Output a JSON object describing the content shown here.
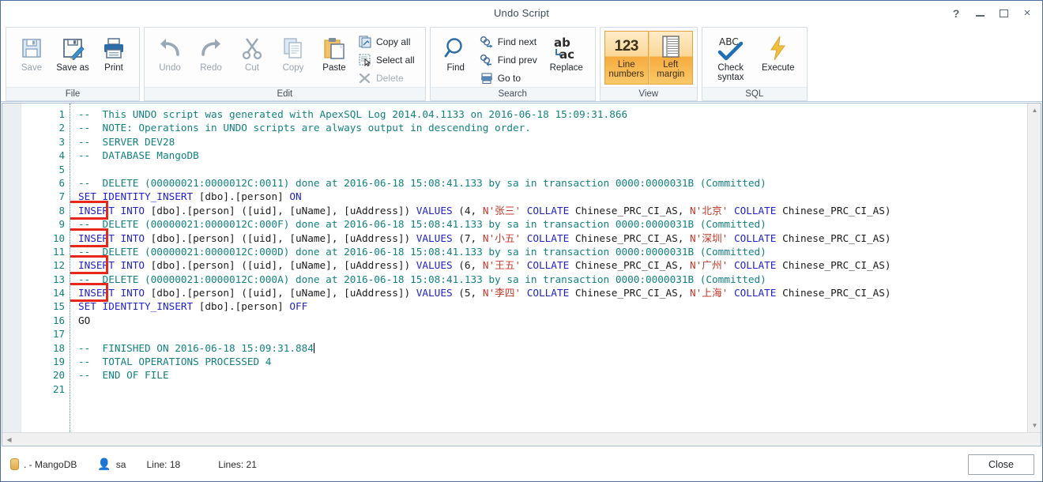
{
  "window": {
    "title": "Undo Script",
    "controls": [
      {
        "name": "help-button",
        "glyph": "?"
      },
      {
        "name": "minimize-button",
        "glyph": ""
      },
      {
        "name": "maximize-button",
        "glyph": ""
      },
      {
        "name": "close-button",
        "glyph": "×"
      }
    ]
  },
  "ribbon": {
    "groups": [
      {
        "label": "File",
        "big": [
          {
            "label": "Save",
            "icon": "save-icon",
            "disabled": true
          },
          {
            "label": "Save as",
            "icon": "save-as-icon",
            "disabled": false
          },
          {
            "label": "Print",
            "icon": "print-icon",
            "disabled": false
          }
        ]
      },
      {
        "label": "Edit",
        "big": [
          {
            "label": "Undo",
            "icon": "undo-icon",
            "disabled": true
          },
          {
            "label": "Redo",
            "icon": "redo-icon",
            "disabled": true
          },
          {
            "label": "Cut",
            "icon": "cut-icon",
            "disabled": true
          },
          {
            "label": "Copy",
            "icon": "copy-icon",
            "disabled": true
          },
          {
            "label": "Paste",
            "icon": "paste-icon",
            "disabled": false
          }
        ],
        "small": [
          {
            "label": "Copy all",
            "icon": "copy-all-icon",
            "disabled": false
          },
          {
            "label": "Select all",
            "icon": "select-all-icon",
            "disabled": false
          },
          {
            "label": "Delete",
            "icon": "delete-icon",
            "disabled": true
          }
        ]
      },
      {
        "label": "Search",
        "big": [
          {
            "label": "Find",
            "icon": "magnifier-icon",
            "disabled": false
          }
        ],
        "small": [
          {
            "label": "Find next",
            "icon": "find-next-icon",
            "disabled": false
          },
          {
            "label": "Find prev",
            "icon": "find-prev-icon",
            "disabled": false
          },
          {
            "label": "Go to",
            "icon": "go-to-icon",
            "disabled": false
          }
        ],
        "big2": [
          {
            "label": "Replace",
            "icon": "replace-icon",
            "disabled": false
          }
        ]
      },
      {
        "label": "View",
        "toggles": [
          {
            "label": "Line\nnumbers",
            "icon": "line-numbers-icon",
            "glyph": "123",
            "active": true
          },
          {
            "label": "Left\nmargin",
            "icon": "left-margin-icon",
            "glyph": "",
            "active": true
          }
        ]
      },
      {
        "label": "SQL",
        "big": [
          {
            "label": "Check\nsyntax",
            "icon": "check-syntax-icon",
            "disabled": false
          },
          {
            "label": "Execute",
            "icon": "execute-icon",
            "disabled": false
          }
        ]
      }
    ]
  },
  "editor": {
    "line_numbers": [
      1,
      2,
      3,
      4,
      5,
      6,
      7,
      8,
      9,
      10,
      11,
      12,
      13,
      14,
      15,
      16,
      17,
      18,
      19,
      20,
      21
    ],
    "colors": {
      "comment": "#138080",
      "keyword": "#2222cc",
      "string": "#c0392b",
      "plain": "#1b1b1b",
      "annotation_box": "#e8261a"
    },
    "lines": [
      {
        "n": 1,
        "tokens": [
          {
            "t": "cm",
            "v": "--  This UNDO script was generated with ApexSQL Log 2014.04.1133 on 2016-06-18 15:09:31.866"
          }
        ]
      },
      {
        "n": 2,
        "tokens": [
          {
            "t": "cm",
            "v": "--  NOTE: Operations in UNDO scripts are always output in descending order."
          }
        ]
      },
      {
        "n": 3,
        "tokens": [
          {
            "t": "cm",
            "v": "--  SERVER DEV28"
          }
        ]
      },
      {
        "n": 4,
        "tokens": [
          {
            "t": "cm",
            "v": "--  DATABASE MangoDB"
          }
        ]
      },
      {
        "n": 5,
        "tokens": []
      },
      {
        "n": 6,
        "tokens": [
          {
            "t": "cm",
            "v": "--  DELETE (00000021:0000012C:0011) done at 2016-06-18 15:08:41.133 by sa in transaction 0000:0000031B (Committed)"
          }
        ]
      },
      {
        "n": 7,
        "tokens": [
          {
            "t": "kw",
            "v": "SET IDENTITY_INSERT"
          },
          {
            "t": "pl",
            "v": " [dbo].[person] "
          },
          {
            "t": "kw",
            "v": "ON"
          }
        ]
      },
      {
        "n": 8,
        "tokens": [
          {
            "t": "kw",
            "v": "INSERT INTO"
          },
          {
            "t": "pl",
            "v": " [dbo].[person] ([uid], [uName], [uAddress]) "
          },
          {
            "t": "kw",
            "v": "VALUES"
          },
          {
            "t": "pl",
            "v": " (4, "
          },
          {
            "t": "st",
            "v": "N'张三'"
          },
          {
            "t": "pl",
            "v": " "
          },
          {
            "t": "kw",
            "v": "COLLATE"
          },
          {
            "t": "pl",
            "v": " Chinese_PRC_CI_AS, "
          },
          {
            "t": "st",
            "v": "N'北京'"
          },
          {
            "t": "pl",
            "v": " "
          },
          {
            "t": "kw",
            "v": "COLLATE"
          },
          {
            "t": "pl",
            "v": " Chinese_PRC_CI_AS)"
          }
        ]
      },
      {
        "n": 9,
        "tokens": [
          {
            "t": "cm",
            "v": "--  DELETE (00000021:0000012C:000F) done at 2016-06-18 15:08:41.133 by sa in transaction 0000:0000031B (Committed)"
          }
        ]
      },
      {
        "n": 10,
        "tokens": [
          {
            "t": "kw",
            "v": "INSERT INTO"
          },
          {
            "t": "pl",
            "v": " [dbo].[person] ([uid], [uName], [uAddress]) "
          },
          {
            "t": "kw",
            "v": "VALUES"
          },
          {
            "t": "pl",
            "v": " (7, "
          },
          {
            "t": "st",
            "v": "N'小五'"
          },
          {
            "t": "pl",
            "v": " "
          },
          {
            "t": "kw",
            "v": "COLLATE"
          },
          {
            "t": "pl",
            "v": " Chinese_PRC_CI_AS, "
          },
          {
            "t": "st",
            "v": "N'深圳'"
          },
          {
            "t": "pl",
            "v": " "
          },
          {
            "t": "kw",
            "v": "COLLATE"
          },
          {
            "t": "pl",
            "v": " Chinese_PRC_CI_AS)"
          }
        ]
      },
      {
        "n": 11,
        "tokens": [
          {
            "t": "cm",
            "v": "--  DELETE (00000021:0000012C:000D) done at 2016-06-18 15:08:41.133 by sa in transaction 0000:0000031B (Committed)"
          }
        ]
      },
      {
        "n": 12,
        "tokens": [
          {
            "t": "kw",
            "v": "INSERT INTO"
          },
          {
            "t": "pl",
            "v": " [dbo].[person] ([uid], [uName], [uAddress]) "
          },
          {
            "t": "kw",
            "v": "VALUES"
          },
          {
            "t": "pl",
            "v": " (6, "
          },
          {
            "t": "st",
            "v": "N'王五'"
          },
          {
            "t": "pl",
            "v": " "
          },
          {
            "t": "kw",
            "v": "COLLATE"
          },
          {
            "t": "pl",
            "v": " Chinese_PRC_CI_AS, "
          },
          {
            "t": "st",
            "v": "N'广州'"
          },
          {
            "t": "pl",
            "v": " "
          },
          {
            "t": "kw",
            "v": "COLLATE"
          },
          {
            "t": "pl",
            "v": " Chinese_PRC_CI_AS)"
          }
        ]
      },
      {
        "n": 13,
        "tokens": [
          {
            "t": "cm",
            "v": "--  DELETE (00000021:0000012C:000A) done at 2016-06-18 15:08:41.133 by sa in transaction 0000:0000031B (Committed)"
          }
        ]
      },
      {
        "n": 14,
        "tokens": [
          {
            "t": "kw",
            "v": "INSERT INTO"
          },
          {
            "t": "pl",
            "v": " [dbo].[person] ([uid], [uName], [uAddress]) "
          },
          {
            "t": "kw",
            "v": "VALUES"
          },
          {
            "t": "pl",
            "v": " (5, "
          },
          {
            "t": "st",
            "v": "N'李四'"
          },
          {
            "t": "pl",
            "v": " "
          },
          {
            "t": "kw",
            "v": "COLLATE"
          },
          {
            "t": "pl",
            "v": " Chinese_PRC_CI_AS, "
          },
          {
            "t": "st",
            "v": "N'上海'"
          },
          {
            "t": "pl",
            "v": " "
          },
          {
            "t": "kw",
            "v": "COLLATE"
          },
          {
            "t": "pl",
            "v": " Chinese_PRC_CI_AS)"
          }
        ]
      },
      {
        "n": 15,
        "tokens": [
          {
            "t": "kw",
            "v": "SET IDENTITY_INSERT"
          },
          {
            "t": "pl",
            "v": " [dbo].[person] "
          },
          {
            "t": "kw",
            "v": "OFF"
          }
        ]
      },
      {
        "n": 16,
        "tokens": [
          {
            "t": "pl",
            "v": "GO"
          }
        ]
      },
      {
        "n": 17,
        "tokens": []
      },
      {
        "n": 18,
        "tokens": [
          {
            "t": "cm",
            "v": "--  FINISHED ON 2016-06-18 15:09:31.884"
          }
        ],
        "caret": true
      },
      {
        "n": 19,
        "tokens": [
          {
            "t": "cm",
            "v": "--  TOTAL OPERATIONS PROCESSED 4"
          }
        ]
      },
      {
        "n": 20,
        "tokens": [
          {
            "t": "cm",
            "v": "--  END OF FILE"
          }
        ]
      },
      {
        "n": 21,
        "tokens": []
      }
    ],
    "annotation_boxes": [
      {
        "name": "insert-highlight-line-8",
        "line": 8
      },
      {
        "name": "insert-highlight-line-10",
        "line": 10
      },
      {
        "name": "insert-highlight-line-12",
        "line": 12
      },
      {
        "name": "insert-highlight-line-14",
        "line": 14
      }
    ]
  },
  "statusbar": {
    "database": ". - MangoDB",
    "user": "sa",
    "line": "Line: 18",
    "lines": "Lines: 21",
    "close_label": "Close"
  }
}
